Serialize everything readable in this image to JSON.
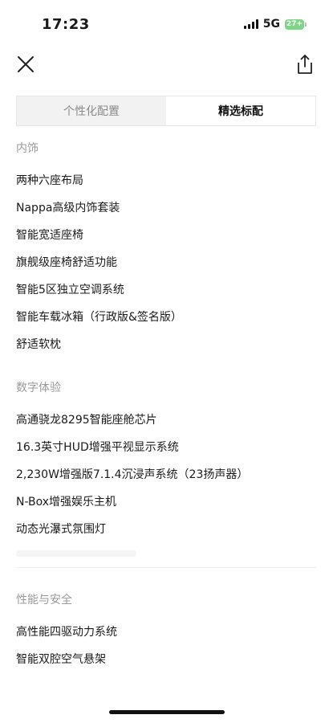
{
  "status_bar": {
    "time": "17:23",
    "network": "5G",
    "battery": "27+",
    "battery_color": "#7fd48a"
  },
  "nav": {
    "close_icon": "close-icon",
    "share_icon": "share-icon"
  },
  "tabs": [
    {
      "label": "个性化配置",
      "active": false
    },
    {
      "label": "精选标配",
      "active": true
    }
  ],
  "sections": [
    {
      "title": "内饰",
      "items": [
        "两种六座布局",
        "Nappa高级内饰套装",
        "智能宽适座椅",
        "旗舰级座椅舒适功能",
        "智能5区独立空调系统",
        "智能车载冰箱（行政版&签名版）",
        "舒适软枕"
      ]
    },
    {
      "title": "数字体验",
      "items": [
        "高通骁龙8295智能座舱芯片",
        "16.3英寸HUD增强平视显示系统",
        "2,230W增强版7.1.4沉浸声系统（23扬声器）",
        "N-Box增强娱乐主机",
        "动态光瀑式氛围灯"
      ]
    },
    {
      "title": "性能与安全",
      "items": [
        "高性能四驱动力系统",
        "智能双腔空气悬架"
      ]
    }
  ],
  "colors": {
    "section_title": "#9a9a9a",
    "text": "#1a1a1a",
    "tab_inactive_bg": "#f2f2f2",
    "tab_active_bg": "#ffffff"
  }
}
